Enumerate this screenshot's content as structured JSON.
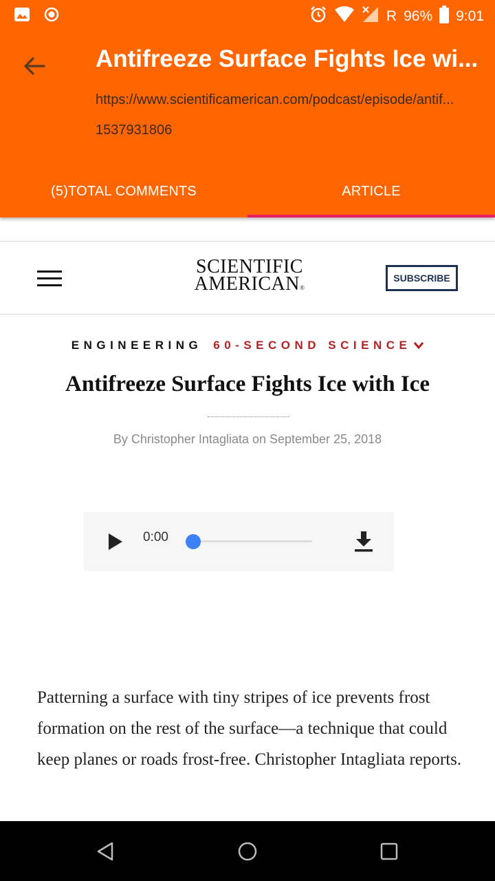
{
  "status_bar": {
    "signal_label": "R",
    "battery": "96%",
    "time": "9:01",
    "icons": [
      "image-icon",
      "record-icon",
      "alarm-icon",
      "wifi-icon",
      "signal-icon",
      "battery-icon"
    ]
  },
  "app_bar": {
    "title": "Antifreeze Surface Fights Ice wi...",
    "url": "https://www.scientificamerican.com/podcast/episode/antif...",
    "id": "1537931806",
    "tabs": [
      {
        "label": "(5)TOTAL COMMENTS",
        "active": false
      },
      {
        "label": "ARTICLE",
        "active": true
      }
    ],
    "colors": {
      "background": "#ff6600",
      "indicator": "#e91e63"
    }
  },
  "site": {
    "logo_line1": "SCIENTIFIC",
    "logo_line2": "AMERICAN",
    "logo_mark": "®",
    "subscribe_label": "SUBSCRIBE"
  },
  "article": {
    "kicker_primary": "ENGINEERING",
    "kicker_secondary": "60-SECOND SCIENCE",
    "headline": "Antifreeze Surface Fights Ice with Ice",
    "byline": "By Christopher Intagliata on September 25, 2018",
    "body": "Patterning a surface with tiny stripes of ice prevents frost formation on the rest of the surface—a technique that could keep planes or roads frost-free. Christopher Intagliata reports."
  },
  "player": {
    "time": "0:00",
    "progress": 0
  },
  "nav_bar": {
    "icons": [
      "back-icon",
      "home-icon",
      "recents-icon"
    ]
  }
}
